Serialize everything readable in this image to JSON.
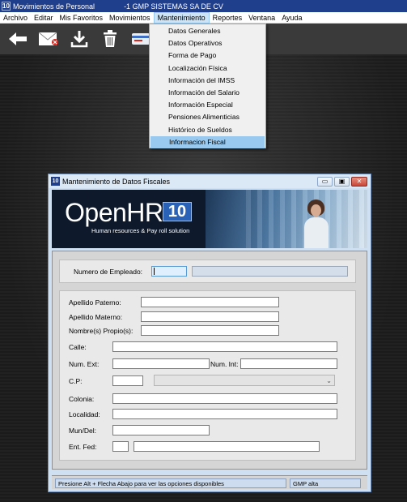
{
  "window": {
    "app_icon": "10",
    "title": "Movimientos de Personal",
    "subtitle": "-1 GMP SISTEMAS SA DE CV"
  },
  "menubar": {
    "items": [
      "Archivo",
      "Editar",
      "Mis Favoritos",
      "Movimientos",
      "Mantenimiento",
      "Reportes",
      "Ventana",
      "Ayuda"
    ],
    "active": "Mantenimiento"
  },
  "toolbar": {
    "icons": [
      "back-arrow-icon",
      "cancel-envelope-icon",
      "download-icon",
      "trash-icon",
      "id-card-icon"
    ]
  },
  "dropdown": {
    "items": [
      "Datos Generales",
      "Datos Operativos",
      "Forma de Pago",
      "Localización Física",
      "Información del IMSS",
      "Información del Salario",
      "Información Especial",
      "Pensiones Alimenticias",
      "Histórico de Sueldos",
      "Informacion Fiscal"
    ],
    "selected": "Informacion Fiscal"
  },
  "child_window": {
    "icon": "10",
    "title": "Mantenimiento de Datos Fiscales",
    "buttons": {
      "minimize": "▭",
      "restore": "▣",
      "close": "✕"
    }
  },
  "banner": {
    "logo": "OpenHR",
    "logo_version": "10",
    "tagline": "Human resources & Pay roll solution"
  },
  "form": {
    "numero_empleado_label": "Numero de Empleado:",
    "numero_empleado_value": "",
    "empleado_nombre_value": "",
    "apellido_paterno_label": "Apellido Paterno:",
    "apellido_materno_label": "Apellido Materno:",
    "nombres_label": "Nombre(s) Propio(s):",
    "calle_label": "Calle:",
    "num_ext_label": "Num. Ext:",
    "num_int_label": "Num. Int:",
    "cp_label": "C.P:",
    "colonia_label": "Colonia:",
    "localidad_label": "Localidad:",
    "mun_del_label": "Mun/Del:",
    "ent_fed_label": "Ent. Fed:"
  },
  "status": {
    "hint": "Presione Alt + Flecha Abajo para ver las opciones disponibles",
    "company": "GMP alta"
  },
  "colors": {
    "titlebar": "#1f3e8c",
    "selected_menu": "#99c9ef",
    "focus_field": "#dfeffe"
  }
}
